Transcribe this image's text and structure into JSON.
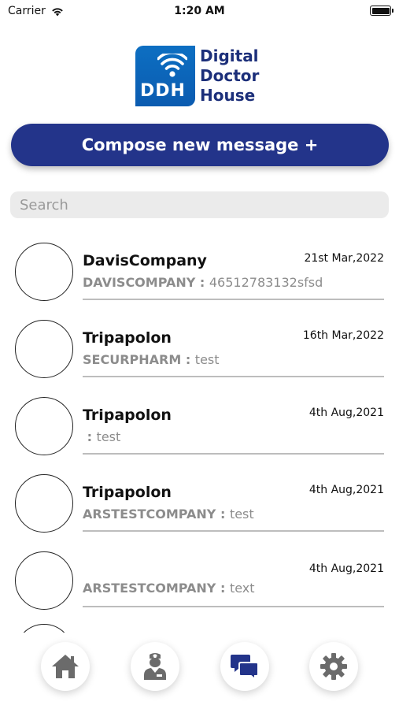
{
  "status_bar": {
    "carrier": "Carrier",
    "time": "1:20 AM"
  },
  "logo": {
    "abbr": "DDH",
    "line1": "Digital",
    "line2": "Doctor",
    "line3": "House"
  },
  "compose": {
    "label": "Compose new message +"
  },
  "search": {
    "placeholder": "Search"
  },
  "messages": [
    {
      "name": "DavisCompany",
      "date": "21st Mar,2022",
      "company": "DAVISCOMPANY : ",
      "text": "46512783132sfsd"
    },
    {
      "name": "Tripapolon",
      "date": "16th Mar,2022",
      "company": "SECURPHARM : ",
      "text": "test"
    },
    {
      "name": "Tripapolon",
      "date": "4th Aug,2021",
      "company": " : ",
      "text": "test"
    },
    {
      "name": "Tripapolon",
      "date": "4th Aug,2021",
      "company": "ARSTESTCOMPANY : ",
      "text": "test"
    },
    {
      "name": "",
      "date": "4th Aug,2021",
      "company": "ARSTESTCOMPANY : ",
      "text": "text"
    }
  ],
  "tabbar": {
    "tabs": [
      {
        "icon": "home-icon"
      },
      {
        "icon": "doctor-icon"
      },
      {
        "icon": "chat-icon",
        "active": true
      },
      {
        "icon": "gear-icon"
      }
    ]
  },
  "colors": {
    "primary": "#23348a",
    "logo_blue": "#0d6fc2",
    "inactive_icon": "#6b6b6b"
  }
}
